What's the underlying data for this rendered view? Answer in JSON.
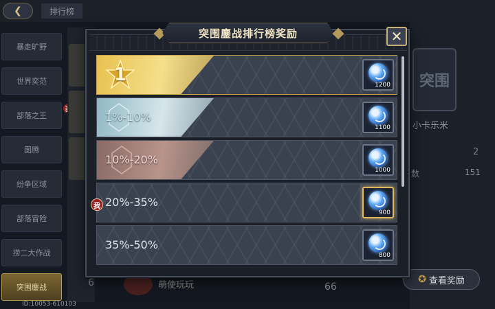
{
  "header": {
    "tab_label": "排行榜",
    "back_icon": "back-arrow-icon"
  },
  "sidebar": {
    "items": [
      {
        "label": "暴走旷野",
        "active": false
      },
      {
        "label": "世界奕范",
        "active": false
      },
      {
        "label": "部落之王",
        "active": false
      },
      {
        "label": "图腾",
        "active": false
      },
      {
        "label": "纷争区域",
        "active": false
      },
      {
        "label": "部落冒险",
        "active": false
      },
      {
        "label": "捞二大作战",
        "active": false
      },
      {
        "label": "突围鏖战",
        "active": true
      }
    ],
    "badge": "我"
  },
  "background": {
    "emblem_text": "突围",
    "player_name": "小卡乐米",
    "stat_a": "2",
    "stat_label": "数",
    "stat_b": "151",
    "view_reward_label": "查看奖励",
    "bottom_rank": "6",
    "bottom_name": "萌使玩玩",
    "bottom_score": "66",
    "id_text": "ID:10053-610103"
  },
  "modal": {
    "title": "突围鏖战排行榜奖励",
    "close_icon": "close-x-icon",
    "rows": [
      {
        "tier": "gold",
        "rank_text": "1",
        "label": "",
        "reward_icon": "blue-orb-icon",
        "quantity": "1200",
        "mine": false
      },
      {
        "tier": "silver",
        "rank_text": "",
        "label": "1%-10%",
        "reward_icon": "blue-orb-icon",
        "quantity": "1100",
        "mine": false
      },
      {
        "tier": "bronze",
        "rank_text": "",
        "label": "10%-20%",
        "reward_icon": "blue-orb-icon",
        "quantity": "1000",
        "mine": false
      },
      {
        "tier": "plain",
        "rank_text": "",
        "label": "20%-35%",
        "reward_icon": "blue-orb-icon",
        "quantity": "900",
        "mine": true,
        "me_badge": "我"
      },
      {
        "tier": "plain",
        "rank_text": "",
        "label": "35%-50%",
        "reward_icon": "blue-orb-icon",
        "quantity": "800",
        "mine": false
      }
    ]
  },
  "colors": {
    "accent_gold": "#c8a24a",
    "reward_orb": "#5da8f5",
    "me_badge": "#9a1e1e"
  }
}
